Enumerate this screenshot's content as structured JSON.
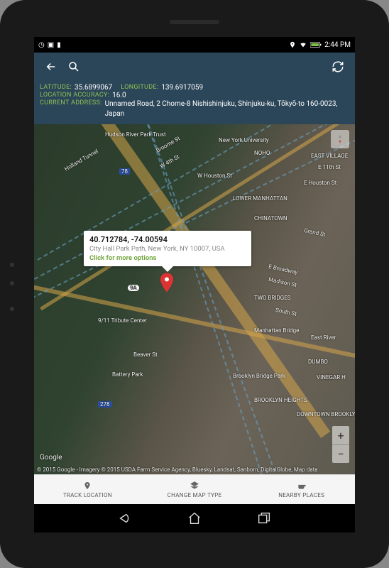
{
  "status": {
    "time": "2:44 PM"
  },
  "info": {
    "lat_label": "LATITUDE:",
    "lat": "35.6899067",
    "lon_label": "LONGITUDE:",
    "lon": "139.6917059",
    "acc_label": "LOCATION ACCURACY:",
    "acc": "16.0",
    "addr_label": "CURRENT ADDRESS:",
    "addr": "Unnamed Road, 2 Chome-8 Nishishinjuku, Shinjuku-ku, Tōkyō-to 160-0023, Japan"
  },
  "callout": {
    "title": "40.712784, -74.00594",
    "sub": "City Hall Park Path, New York, NY 10007, USA",
    "link": "Click for more options"
  },
  "map_labels": {
    "parktrust": "Hudson River Park Trust",
    "holland": "Holland Tunnel",
    "nyu": "New York University",
    "noho": "NOHO",
    "houston1": "W Houston St",
    "houston2": "E Houston St",
    "lower_manhattan": "LOWER MANHATTAN",
    "chinatown": "CHINATOWN",
    "east_village": "EAST VILLAGE",
    "e11th": "E 11th St",
    "w4th": "W 4th St",
    "broome": "Broome St",
    "e_broadway": "E Broadway",
    "madison": "Madison St",
    "south": "South St",
    "tribute": "9/11 Tribute Center",
    "beaver": "Beaver St",
    "battery": "Battery Park",
    "manhattan_bridge": "Manhattan Bridge",
    "two_bridges": "TWO BRIDGES",
    "east_river": "East River",
    "brooklyn_bridge_park": "Brooklyn Bridge Park",
    "brooklyn_heights": "BROOKLYN HEIGHTS",
    "dumbo": "DUMBO",
    "vinegar": "VINEGAR H",
    "downtown_brooklyn": "DOWNTOWN BROOKLYN",
    "grand": "Grand St",
    "route_9a": "9A",
    "route_78a": "78",
    "route_278": "278",
    "google": "Google",
    "attrib": "© 2015 Google - Imagery © 2015 USDA Farm Service Agency, Bluesky, Landsat, Sanborn, DigitalGlobe, Map data"
  },
  "actions": {
    "track": "TRACK LOCATION",
    "change": "CHANGE MAP TYPE",
    "nearby": "NEARBY PLACES"
  }
}
